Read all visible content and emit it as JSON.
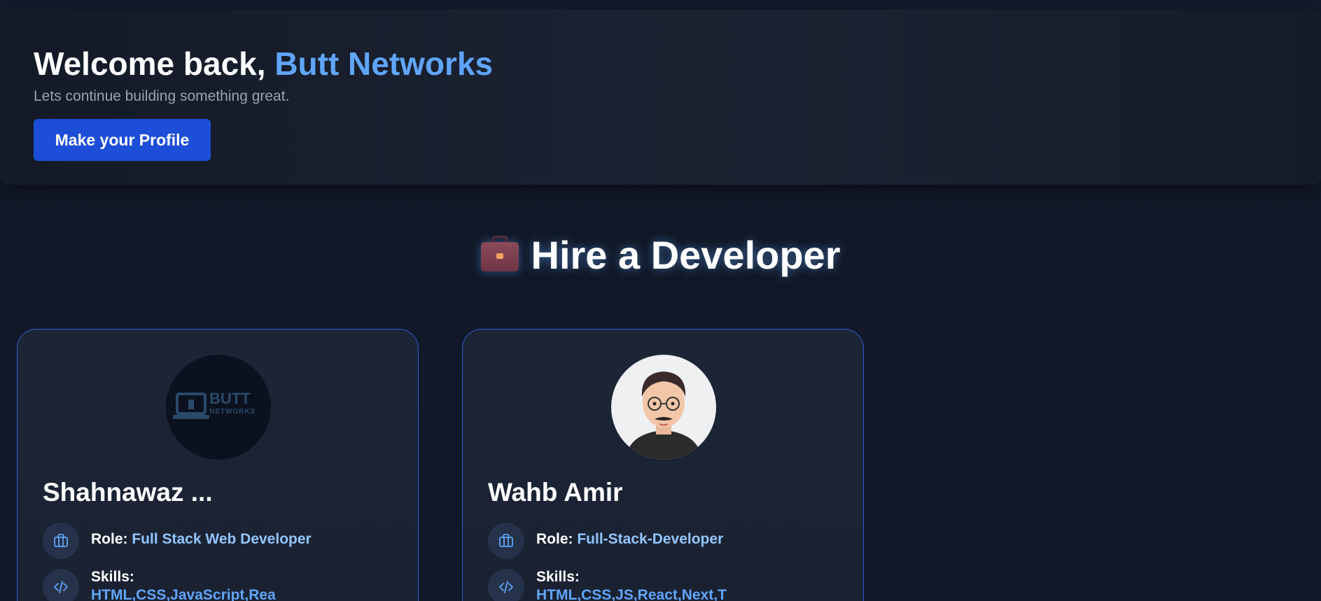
{
  "welcome": {
    "greeting": "Welcome back, ",
    "user_name": "Butt Networks",
    "subtitle": "Lets continue building something great.",
    "profile_button": "Make your Profile"
  },
  "section": {
    "title": "Hire a Developer",
    "icon": "briefcase-icon"
  },
  "developers": [
    {
      "name": "Shahnawaz ...",
      "avatar": "butt-networks-logo",
      "avatar_text": "BUTT",
      "avatar_subtext": "NETWORKS",
      "role_label": "Role:",
      "role": "Full Stack Web Developer",
      "skills_label": "Skills:",
      "skills": "HTML,CSS,JavaScript,Rea"
    },
    {
      "name": "Wahb Amir",
      "avatar": "cartoon-portrait",
      "role_label": "Role:",
      "role": "Full-Stack-Developer",
      "skills_label": "Skills:",
      "skills": "HTML,CSS,JS,React,Next,T"
    }
  ],
  "colors": {
    "background": "#111827",
    "accent": "#60a5fa",
    "button": "#1d4ed8",
    "card_border": "#2f5bd6"
  }
}
